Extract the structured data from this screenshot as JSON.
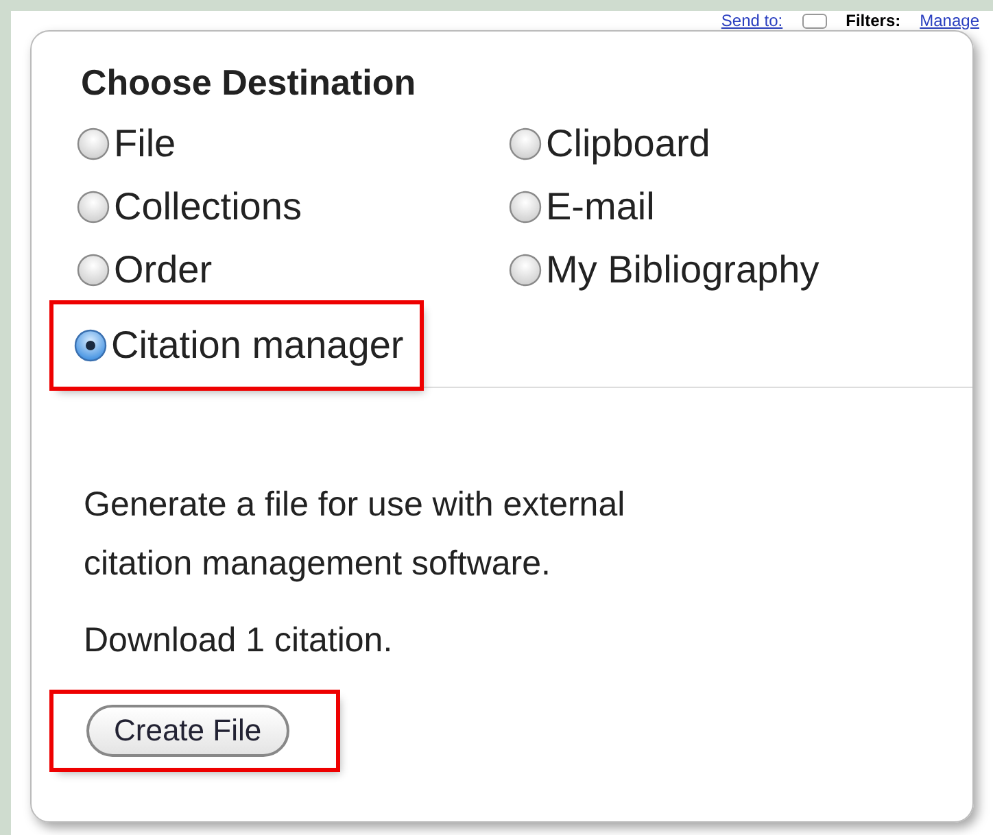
{
  "top_bar": {
    "send_to_link": "Send to:",
    "filters_label": "Filters:",
    "filters_link": "Manage"
  },
  "popup": {
    "title": "Choose Destination",
    "options": [
      {
        "label": "File",
        "selected": false,
        "highlighted": false
      },
      {
        "label": "Clipboard",
        "selected": false,
        "highlighted": false
      },
      {
        "label": "Collections",
        "selected": false,
        "highlighted": false
      },
      {
        "label": "E-mail",
        "selected": false,
        "highlighted": false
      },
      {
        "label": "Order",
        "selected": false,
        "highlighted": false
      },
      {
        "label": "My Bibliography",
        "selected": false,
        "highlighted": false
      },
      {
        "label": "Citation manager",
        "selected": true,
        "highlighted": true
      }
    ],
    "description": "Generate a file for use with external citation management software.",
    "count_text": "Download 1 citation.",
    "button": {
      "label": "Create File",
      "highlighted": true
    }
  }
}
